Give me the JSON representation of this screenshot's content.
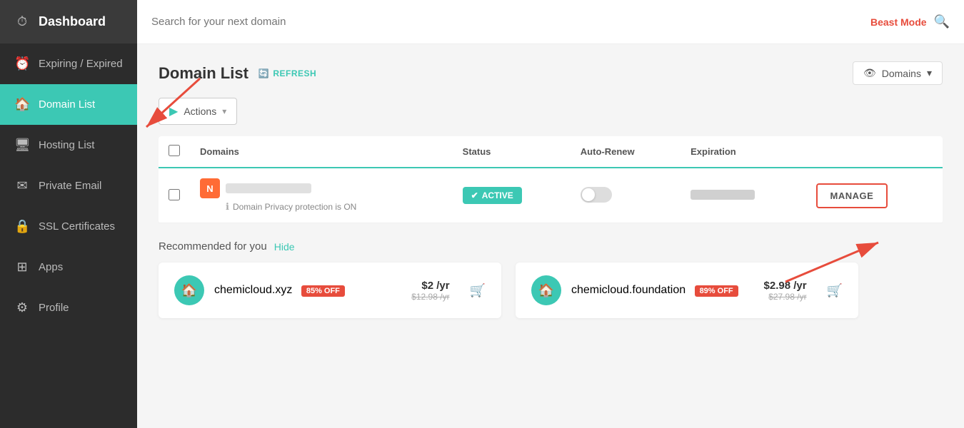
{
  "sidebar": {
    "dashboard_label": "Dashboard",
    "items": [
      {
        "id": "dashboard",
        "label": "Dashboard",
        "icon": "⏱",
        "active": false
      },
      {
        "id": "expiring",
        "label": "Expiring / Expired",
        "icon": "⏰",
        "active": false
      },
      {
        "id": "domain-list",
        "label": "Domain List",
        "icon": "🏠",
        "active": true
      },
      {
        "id": "hosting-list",
        "label": "Hosting List",
        "icon": "🖥",
        "active": false
      },
      {
        "id": "private-email",
        "label": "Private Email",
        "icon": "✉",
        "active": false
      },
      {
        "id": "ssl-certificates",
        "label": "SSL Certificates",
        "icon": "🔒",
        "active": false
      },
      {
        "id": "apps",
        "label": "Apps",
        "icon": "⊞",
        "active": false
      },
      {
        "id": "profile",
        "label": "Profile",
        "icon": "⚙",
        "active": false
      }
    ]
  },
  "search": {
    "placeholder": "Search for your next domain",
    "beast_mode_label": "Beast Mode"
  },
  "domain_list": {
    "title": "Domain List",
    "refresh_label": "REFRESH",
    "domains_dropdown_label": "Domains",
    "actions_label": "Actions",
    "table": {
      "columns": [
        "Domains",
        "Status",
        "Auto-Renew",
        "Expiration"
      ],
      "rows": [
        {
          "logo_letter": "N",
          "domain_name": "",
          "privacy_text": "Domain Privacy protection is ON",
          "status": "ACTIVE",
          "manage_label": "MANAGE"
        }
      ]
    }
  },
  "recommended": {
    "title": "Recommended for you",
    "hide_label": "Hide",
    "cards": [
      {
        "domain": "chemicloud.xyz",
        "discount": "85% OFF",
        "price": "$2 /yr",
        "original_price": "$12.98 /yr"
      },
      {
        "domain": "chemicloud.foundation",
        "discount": "89% OFF",
        "price": "$2.98 /yr",
        "original_price": "$27.98 /yr"
      }
    ]
  }
}
